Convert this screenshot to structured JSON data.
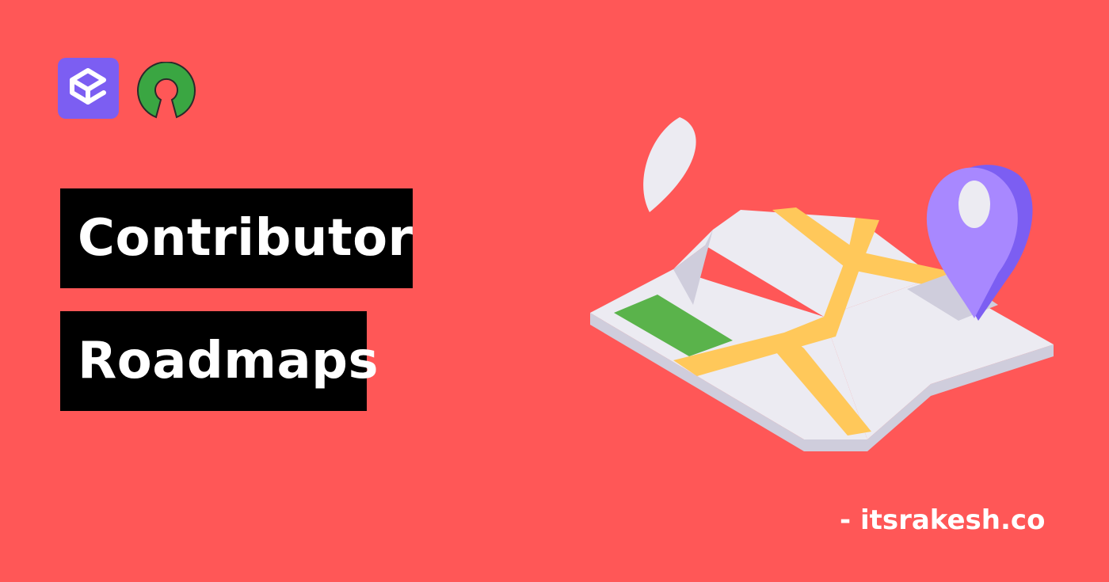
{
  "colors": {
    "background": "#ff5757",
    "title_box": "#000000",
    "title_text": "#ffffff",
    "app_logo": "#7c5ef2",
    "osi_logo": "#3aa642",
    "map_surface": "#ecebf2",
    "map_side": "#cfcddc",
    "road": "#ffc85a",
    "park": "#5ab34b",
    "pin_front": "#a888ff",
    "pin_side": "#7c5ef2"
  },
  "icons": {
    "app_logo": "open-sauced-logo-icon",
    "osi_logo": "open-source-initiative-logo-icon",
    "leaf": "leaf-icon",
    "map": "folded-map-icon",
    "pin": "location-pin-icon"
  },
  "title": {
    "line1": "Contributor",
    "line2": "Roadmaps"
  },
  "credit": "- itsrakesh.co"
}
